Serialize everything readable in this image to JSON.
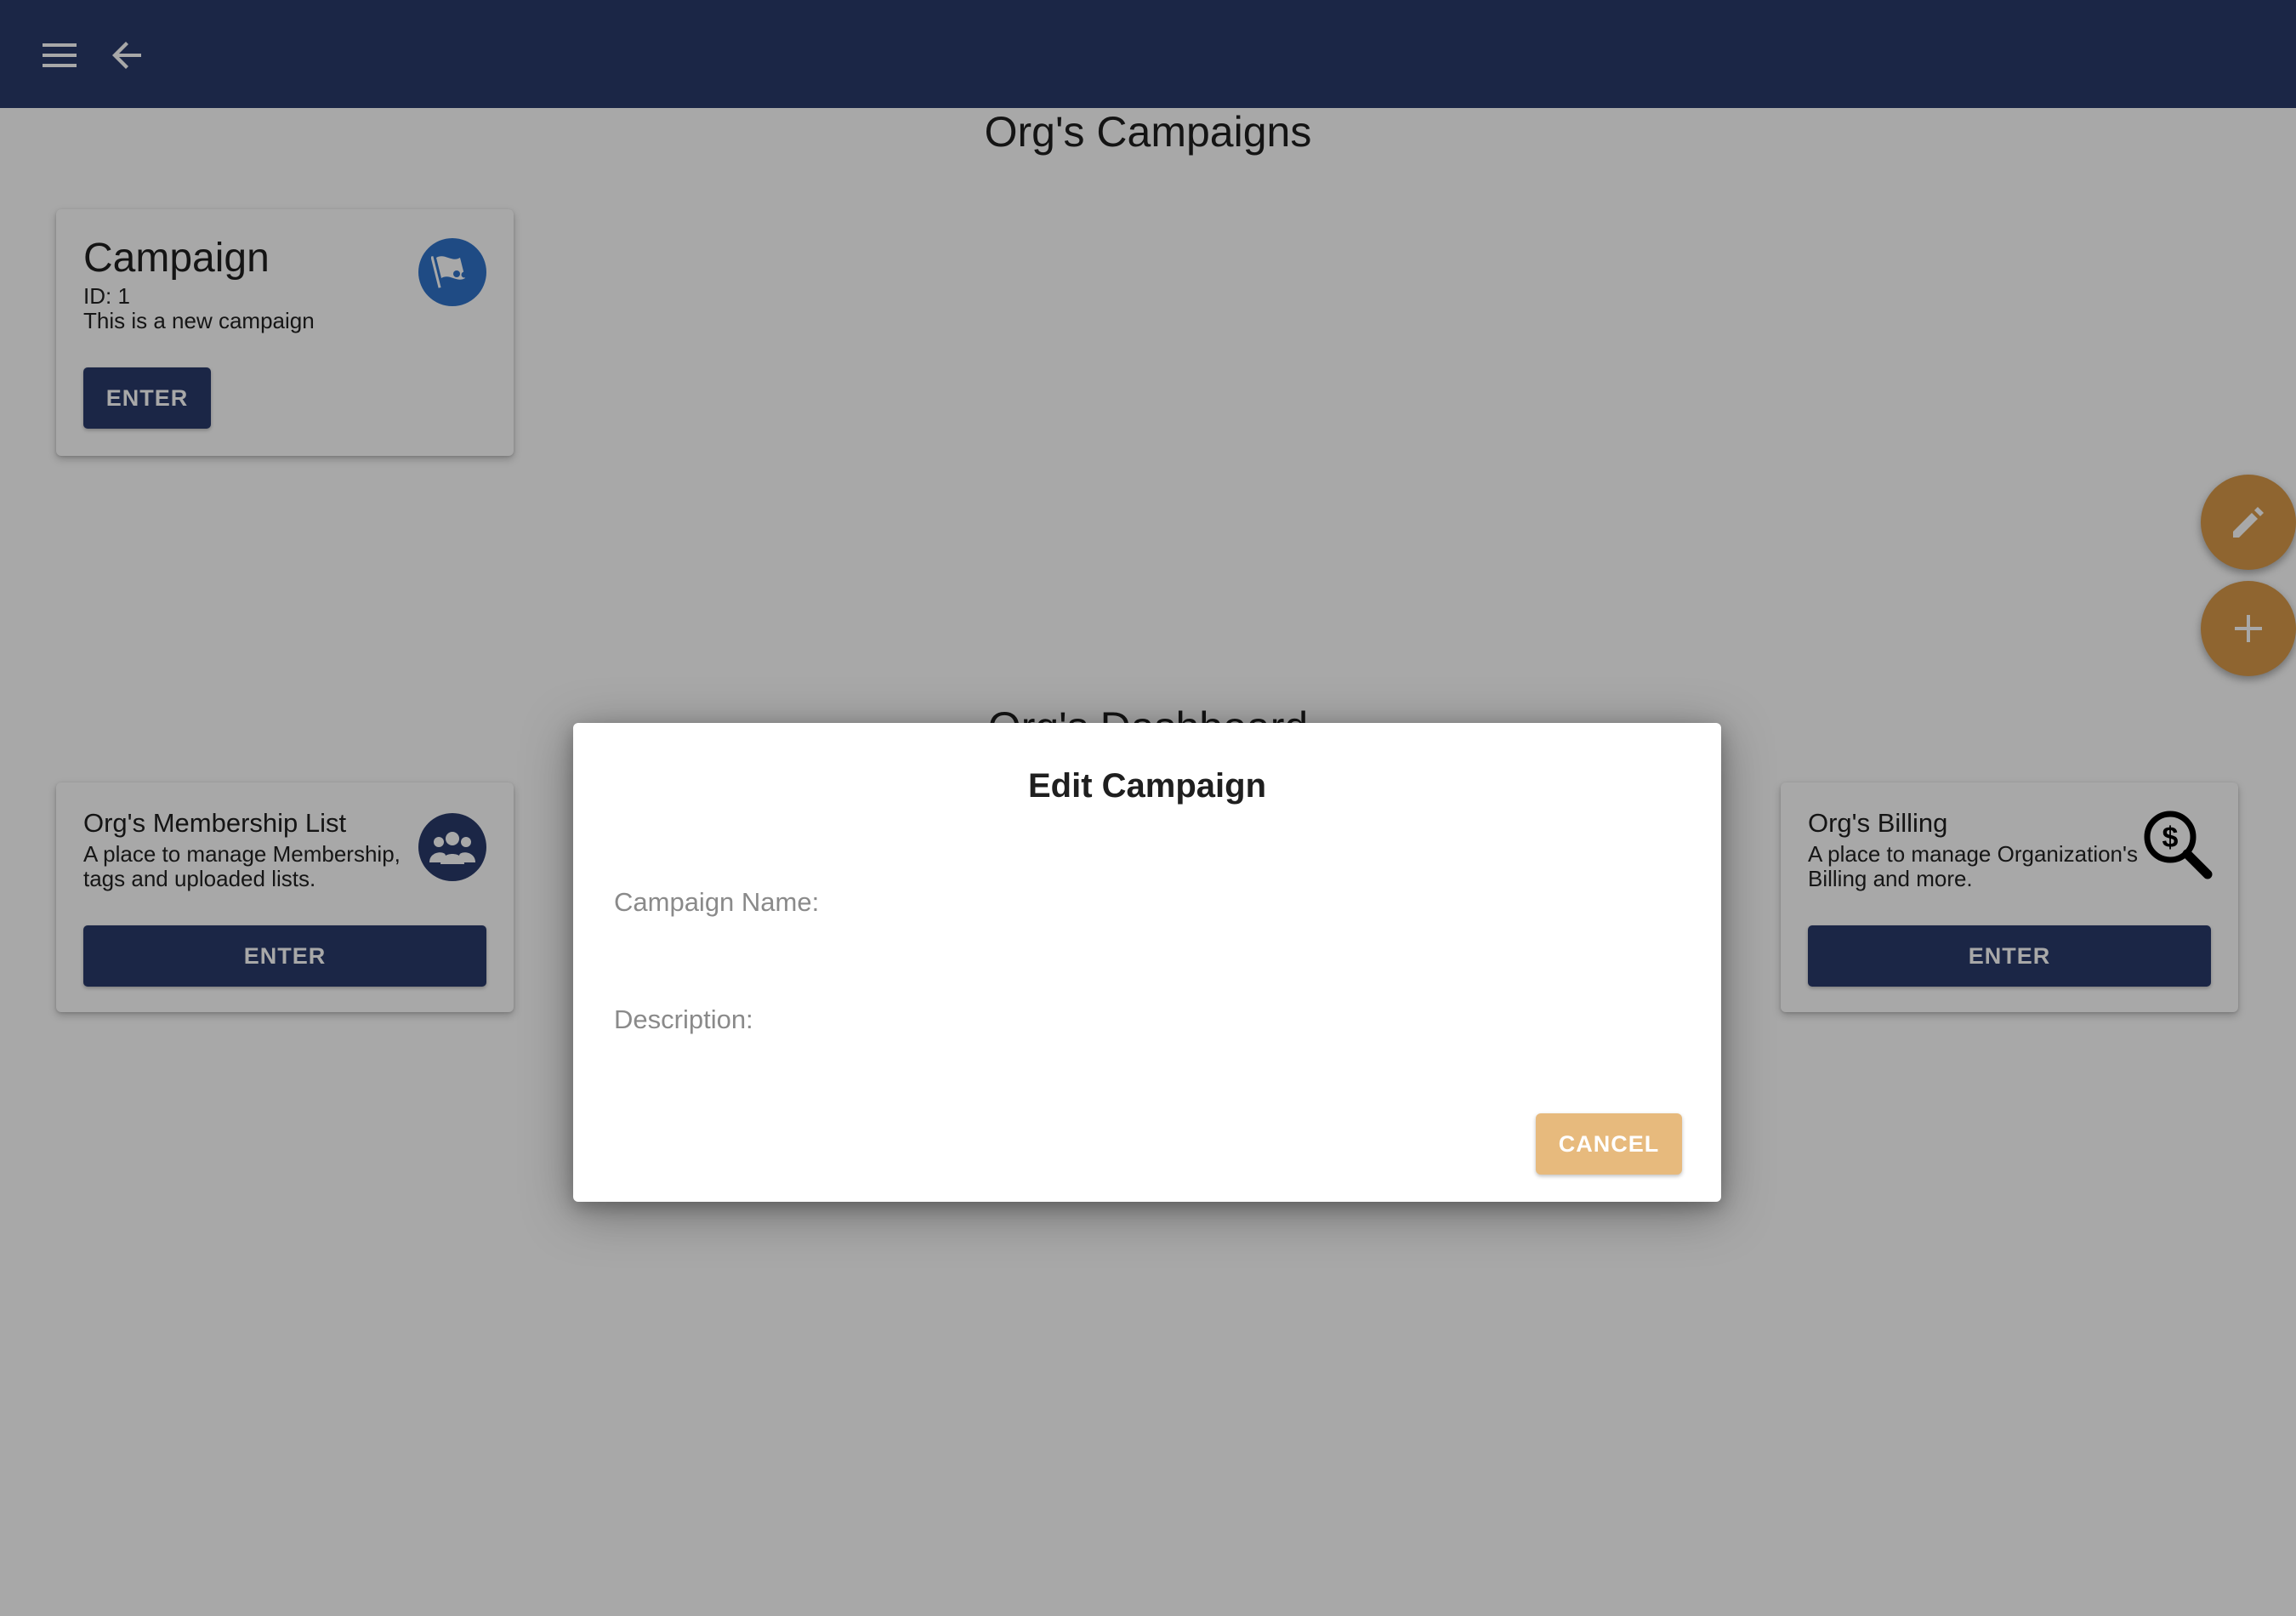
{
  "appbar": {
    "menu_icon": "menu-icon",
    "back_icon": "arrow-back-icon",
    "color": "#2a3b6b"
  },
  "campaigns": {
    "title": "Org's Campaigns",
    "cards": [
      {
        "title": "Campaign",
        "id_text": "ID: 1",
        "description": "This is a new campaign",
        "button_label": "ENTER",
        "icon": "campaign-flag-icon"
      }
    ]
  },
  "dashboard": {
    "title": "Org's Dashboard",
    "cards": [
      {
        "title": "Org's Membership List",
        "description": "A place to manage Membership, tags and uploaded lists.",
        "button_label": "ENTER",
        "icon": "group-icon"
      },
      {
        "title": "Org's Billing",
        "description": "A place to manage Organization's Billing and more.",
        "button_label": "ENTER",
        "icon": "billing-search-icon"
      }
    ]
  },
  "fabs": {
    "edit_icon": "pencil-icon",
    "add_icon": "plus-icon",
    "color": "#d99a4a"
  },
  "dialog": {
    "title": "Edit Campaign",
    "fields": {
      "name": {
        "label": "Campaign Name:",
        "value": ""
      },
      "description": {
        "label": "Description:",
        "value": ""
      }
    },
    "cancel_label": "CANCEL",
    "cancel_color": "#e7ba7d"
  }
}
